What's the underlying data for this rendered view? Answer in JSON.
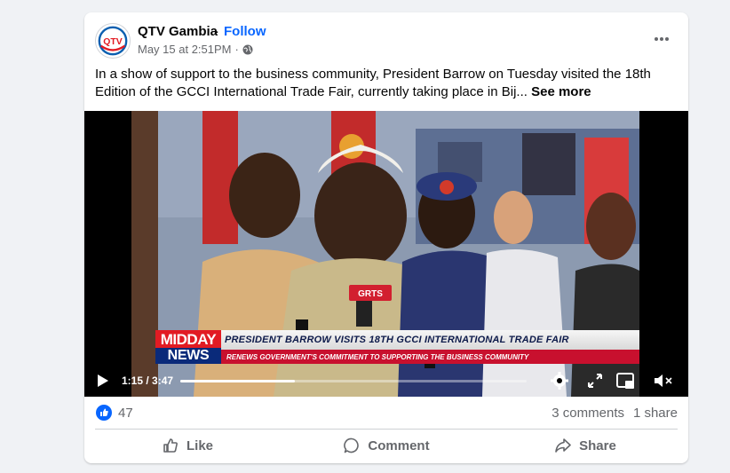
{
  "post": {
    "page_name": "QTV Gambia",
    "separator": "·",
    "follow_label": "Follow",
    "timestamp": "May 15 at 2:51PM",
    "meta_separator": "·",
    "avatar_logo_text": "QTV",
    "caption": "In a show of support to the business community, President Barrow on Tuesday visited the 18th Edition of the GCCI International Trade Fair, currently taking place in Bij...",
    "see_more_label": "See more"
  },
  "video": {
    "ticker_label_top": "MIDDAY",
    "ticker_label_bottom": "NEWS",
    "headline": "PRESIDENT BARROW VISITS 18TH GCCI INTERNATIONAL TRADE FAIR",
    "subheadline": "RENEWS GOVERNMENT'S COMMITMENT TO SUPPORTING THE BUSINESS COMMUNITY",
    "mic_label": "GRTS",
    "time_display": "1:15 / 3:47",
    "progress_fraction": 0.33
  },
  "stats": {
    "like_count": "47",
    "comments_label": "3 comments",
    "shares_label": "1 share"
  },
  "actions": {
    "like_label": "Like",
    "comment_label": "Comment",
    "share_label": "Share"
  },
  "colors": {
    "accent": "#0866ff",
    "muted_text": "#65676b",
    "ticker_red": "#e21b23",
    "ticker_blue": "#0a2a7a"
  }
}
